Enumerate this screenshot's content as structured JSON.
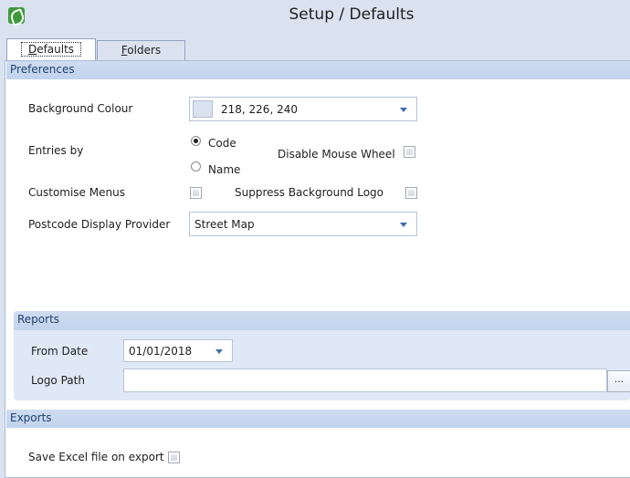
{
  "window": {
    "title": "Setup / Defaults"
  },
  "tabs": [
    {
      "label_first": "D",
      "label_rest": "efaults"
    },
    {
      "label_first": "F",
      "label_rest": "olders"
    }
  ],
  "preferences": {
    "header": "Preferences",
    "background_colour": {
      "label": "Background Colour",
      "value": "218, 226, 240",
      "swatch_color": "#dae2f0"
    },
    "entries_by": {
      "label": "Entries by",
      "options": [
        "Code",
        "Name"
      ],
      "selected": "Code"
    },
    "disable_mouse_wheel": {
      "label": "Disable Mouse Wheel",
      "checked": false
    },
    "customise_menus": {
      "label": "Customise Menus",
      "checked": false
    },
    "suppress_background_logo": {
      "label": "Suppress Background Logo",
      "checked": false
    },
    "postcode_provider": {
      "label": "Postcode Display Provider",
      "value": "Street Map"
    }
  },
  "reports": {
    "header": "Reports",
    "from_date": {
      "label": "From Date",
      "value": "01/01/2018"
    },
    "logo_path": {
      "label": "Logo Path",
      "value": "",
      "button": "..."
    }
  },
  "exports": {
    "header": "Exports",
    "save_excel": {
      "label": "Save Excel file on export",
      "checked": false
    }
  },
  "colors": {
    "accent": "#3d6fb3",
    "group_header": "#c6d6ee",
    "group_body": "#dfe8f6"
  },
  "icons": [
    "app-icon",
    "dropdown-arrow-icon"
  ]
}
